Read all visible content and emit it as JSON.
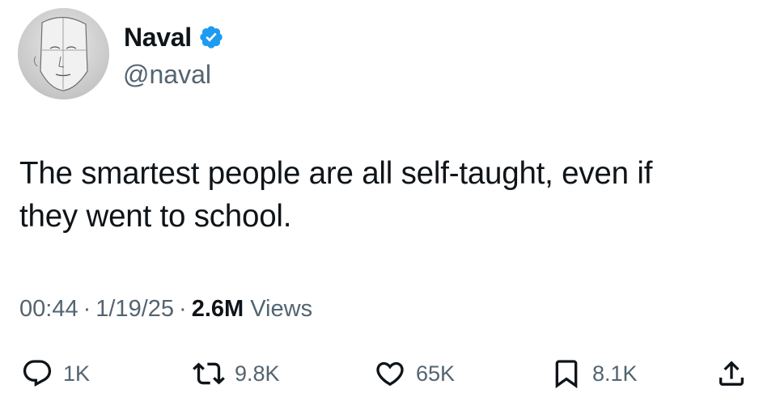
{
  "author": {
    "display_name": "Naval",
    "handle": "@naval",
    "verified": true,
    "verified_color": "#1d9bf0",
    "avatar_icon": "avatar-sketch-face"
  },
  "tweet": {
    "text": "The smartest people are all self-taught, even if\nthey went to school."
  },
  "meta": {
    "time": "00:44",
    "separator": "·",
    "date": "1/19/25",
    "views_count": "2.6M",
    "views_label": "Views"
  },
  "actions": {
    "reply_count": "1K",
    "retweet_count": "9.8K",
    "like_count": "65K",
    "bookmark_count": "8.1K",
    "icons": [
      "reply-icon",
      "retweet-icon",
      "like-icon",
      "bookmark-icon",
      "share-icon"
    ]
  },
  "colors": {
    "text_primary": "#0f1419",
    "text_secondary": "#536471",
    "background": "#ffffff"
  }
}
